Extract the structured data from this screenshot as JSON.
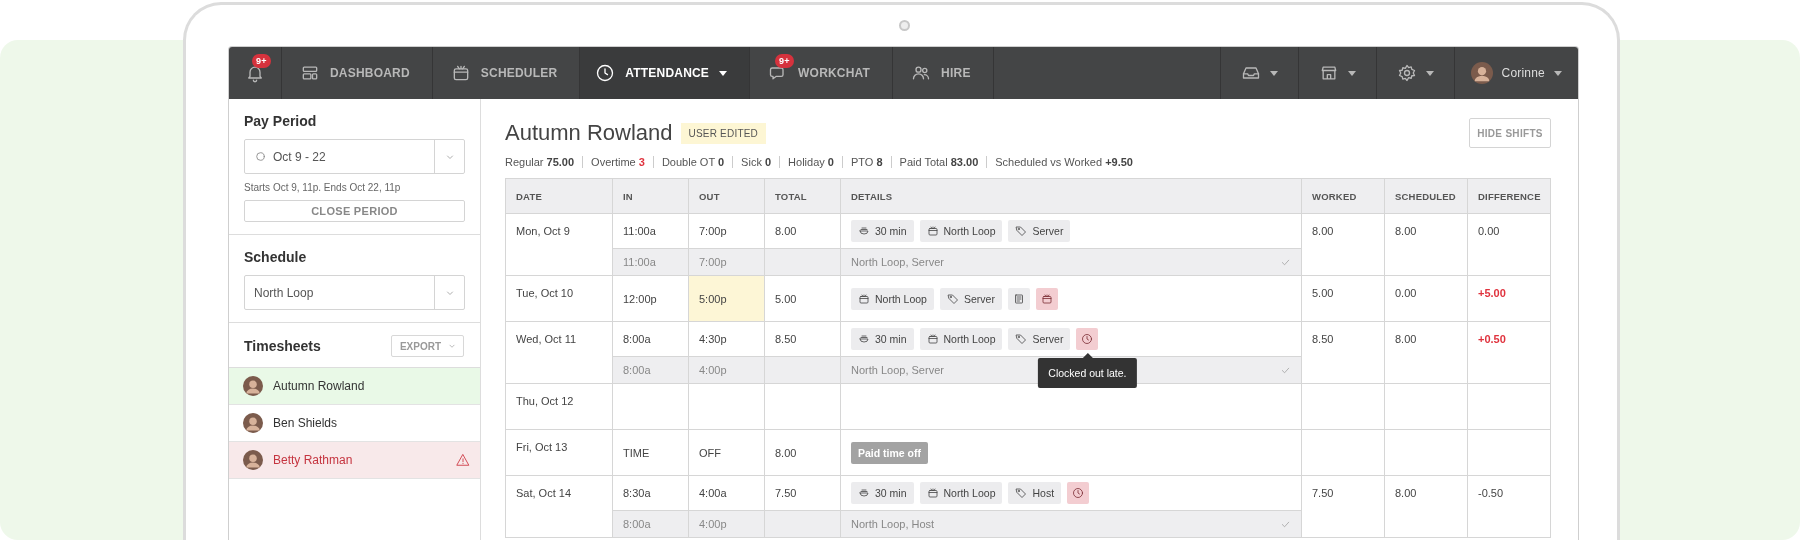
{
  "nav": {
    "left": [
      {
        "badge": "9+",
        "selected": false
      },
      {
        "label": "DASHBOARD",
        "selected": false
      },
      {
        "label": "SCHEDULER",
        "selected": false
      },
      {
        "label": "ATTENDANCE",
        "selected": true,
        "dropdown": true
      },
      {
        "label": "WORKCHAT",
        "badge": "9+",
        "selected": false
      },
      {
        "label": "HIRE",
        "selected": false
      }
    ],
    "right": [
      {
        "dropdown": true
      },
      {
        "dropdown": true
      },
      {
        "dropdown": true
      },
      {
        "label": "Corinne",
        "avatar": true,
        "dropdown": true
      }
    ]
  },
  "sidebar": {
    "pay_period": {
      "title": "Pay Period",
      "value": "Oct 9 - 22",
      "note": "Starts Oct 9, 11p. Ends Oct 22, 11p",
      "button": "CLOSE PERIOD"
    },
    "schedule": {
      "title": "Schedule",
      "value": "North Loop"
    },
    "timesheets": {
      "title": "Timesheets",
      "export": "EXPORT",
      "items": [
        {
          "name": "Autumn Rowland",
          "selected": true,
          "alert": false
        },
        {
          "name": "Ben Shields",
          "selected": false,
          "alert": false
        },
        {
          "name": "Betty Rathman",
          "selected": false,
          "alert": true
        }
      ]
    }
  },
  "header": {
    "name": "Autumn Rowland",
    "badge": "USER EDITED",
    "button": "HIDE SHIFTS"
  },
  "stats": [
    {
      "label": "Regular",
      "value": "75.00",
      "warn": false
    },
    {
      "label": "Overtime",
      "value": "3",
      "warn": true
    },
    {
      "label": "Double OT",
      "value": "0",
      "warn": false
    },
    {
      "label": "Sick",
      "value": "0",
      "warn": false
    },
    {
      "label": "Holiday",
      "value": "0",
      "warn": false
    },
    {
      "label": "PTO",
      "value": "8",
      "warn": false
    },
    {
      "label": "Paid Total",
      "value": "83.00",
      "warn": false
    },
    {
      "label": "Scheduled vs Worked",
      "value": "+9.50",
      "warn": false
    }
  ],
  "table": {
    "columns": [
      "DATE",
      "IN",
      "OUT",
      "TOTAL",
      "DETAILS",
      "WORKED",
      "SCHEDULED",
      "DIFFERENCE"
    ],
    "rows": [
      {
        "date": "Mon, Oct 9",
        "in": "11:00a",
        "out": "7:00p",
        "out_edited": false,
        "total": "8.00",
        "chips": [
          {
            "kind": "break",
            "text": "30 min"
          },
          {
            "kind": "location",
            "text": "North Loop"
          },
          {
            "kind": "position",
            "text": "Server"
          }
        ],
        "worked": "8.00",
        "scheduled": "8.00",
        "difference": "0.00",
        "over": false,
        "shift": {
          "in": "11:00a",
          "out": "7:00p",
          "details": "North Loop, Server",
          "matched": true
        }
      },
      {
        "date": "Tue, Oct 10",
        "in": "12:00p",
        "out": "5:00p",
        "out_edited": true,
        "total": "5.00",
        "chips": [
          {
            "kind": "location",
            "text": "North Loop"
          },
          {
            "kind": "position",
            "text": "Server"
          },
          {
            "kind": "note"
          },
          {
            "kind": "location_alert"
          }
        ],
        "worked": "5.00",
        "scheduled": "0.00",
        "difference": "+5.00",
        "over": true
      },
      {
        "date": "Wed, Oct 11",
        "in": "8:00a",
        "out": "4:30p",
        "out_edited": false,
        "total": "8.50",
        "chips": [
          {
            "kind": "break",
            "text": "30 min"
          },
          {
            "kind": "location",
            "text": "North Loop"
          },
          {
            "kind": "position",
            "text": "Server"
          },
          {
            "kind": "clock_alert",
            "tooltip": "Clocked out late."
          }
        ],
        "worked": "8.50",
        "scheduled": "8.00",
        "difference": "+0.50",
        "over": true,
        "shift": {
          "in": "8:00a",
          "out": "4:00p",
          "details": "North Loop, Server",
          "matched": true
        }
      },
      {
        "date": "Thu, Oct 12"
      },
      {
        "date": "Fri, Oct 13",
        "in": "TIME",
        "out": "OFF",
        "out_edited": false,
        "total": "8.00",
        "chips": [
          {
            "kind": "pto",
            "text": "Paid time off"
          }
        ]
      },
      {
        "date": "Sat, Oct 14",
        "in": "8:30a",
        "out": "4:00a",
        "out_edited": false,
        "total": "7.50",
        "chips": [
          {
            "kind": "break",
            "text": "30 min"
          },
          {
            "kind": "location",
            "text": "North Loop"
          },
          {
            "kind": "position",
            "text": "Host"
          },
          {
            "kind": "clock_alert"
          }
        ],
        "worked": "7.50",
        "scheduled": "8.00",
        "difference": "-0.50",
        "over": false,
        "shift": {
          "in": "8:00a",
          "out": "4:00p",
          "details": "North Loop, Host",
          "matched": true
        }
      }
    ]
  }
}
